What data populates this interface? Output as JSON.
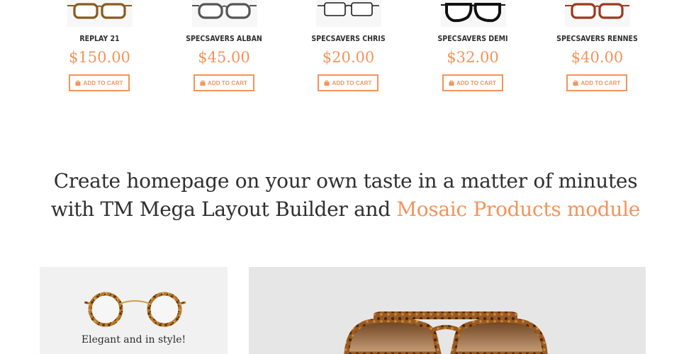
{
  "products": [
    {
      "name": "REPLAY 21",
      "price": "$150.00",
      "button": "ADD TO CART",
      "frame_color": "#8a5a1f",
      "style": "tortoise"
    },
    {
      "name": "SPECSAVERS ALBAN",
      "price": "$45.00",
      "button": "ADD TO CART",
      "frame_color": "#555555",
      "style": "grey"
    },
    {
      "name": "SPECSAVERS CHRIS",
      "price": "$20.00",
      "button": "ADD TO CART",
      "frame_color": "#1a1a1a",
      "style": "wire"
    },
    {
      "name": "SPECSAVERS DEMI",
      "price": "$32.00",
      "button": "ADD TO CART",
      "frame_color": "#111111",
      "style": "black"
    },
    {
      "name": "SPECSAVERS RENNES",
      "price": "$40.00",
      "button": "ADD TO CART",
      "frame_color": "#9a3a1e",
      "style": "red"
    }
  ],
  "headline": {
    "line1": "Create homepage on your own taste in a matter of minutes",
    "line2_prefix": "with TM Mega Layout Builder and ",
    "line2_accent": "Mosaic Products module"
  },
  "banners": {
    "left_caption": "Elegant and in style!"
  },
  "colors": {
    "accent": "#f3945b",
    "text": "#2f2f2f"
  },
  "icons": {
    "cart": "shopping-bag-icon"
  }
}
